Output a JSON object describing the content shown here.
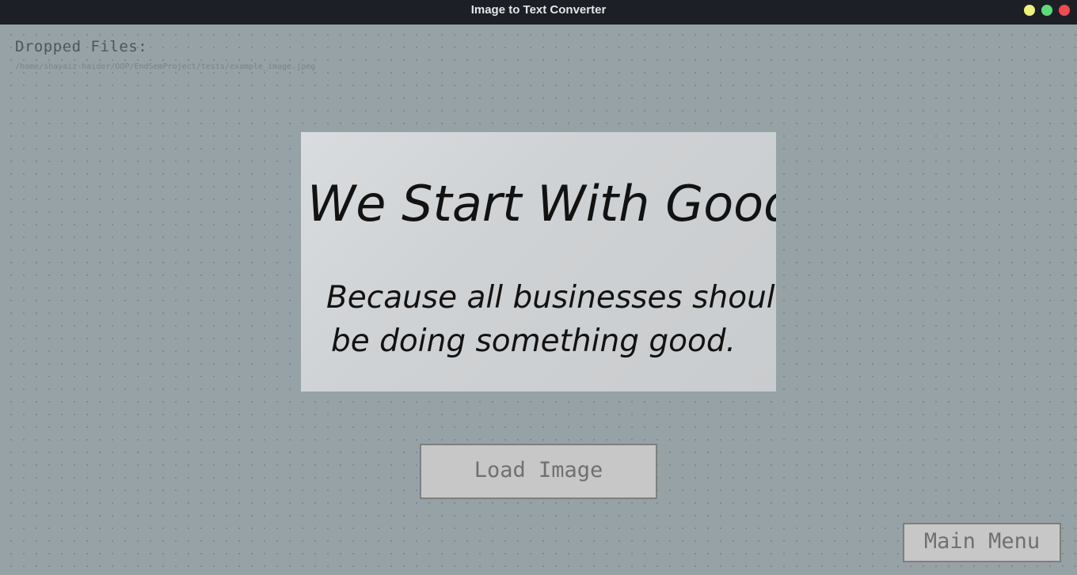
{
  "window": {
    "title": "Image to Text Converter"
  },
  "dropped": {
    "heading": "Dropped Files:",
    "path": "/home/shayaiz-haider/OOP/EndSemProject/tests/example_image.jpeg"
  },
  "preview": {
    "line1": "We Start With Good",
    "line2": "Because all businesses should",
    "line3": "be doing something good."
  },
  "buttons": {
    "load_label": "Load Image",
    "menu_label": "Main Menu"
  },
  "colors": {
    "background": "#96a2a5",
    "titlebar": "#1d1f27",
    "button_face": "#c7c7c7",
    "minimize": "#eef27a",
    "maximize": "#5cdc78",
    "close": "#ef4b51"
  }
}
